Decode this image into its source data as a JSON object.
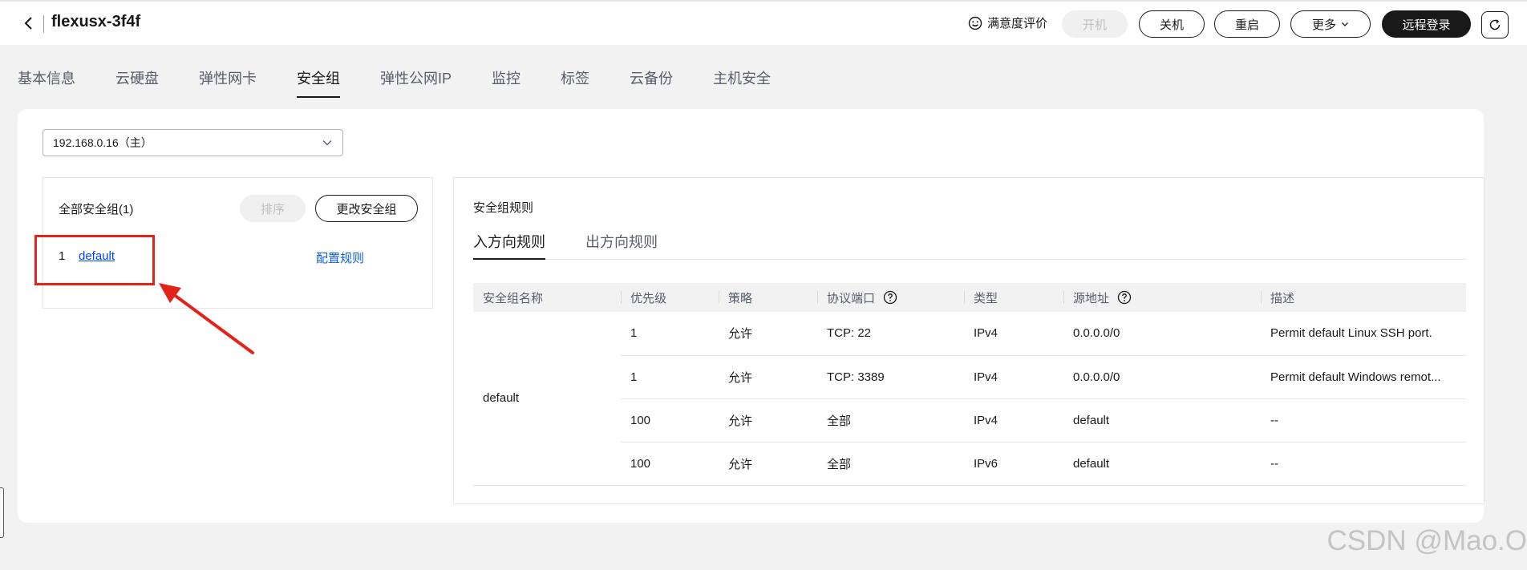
{
  "header": {
    "title": "flexusx-3f4f",
    "satisfaction": "满意度评价",
    "buttons": {
      "power_on": "开机",
      "shutdown": "关机",
      "restart": "重启",
      "more": "更多",
      "remote_login": "远程登录"
    }
  },
  "tabs": [
    "基本信息",
    "云硬盘",
    "弹性网卡",
    "安全组",
    "弹性公网IP",
    "监控",
    "标签",
    "云备份",
    "主机安全"
  ],
  "active_tab": "安全组",
  "ip_select": {
    "value": "192.168.0.16（主）"
  },
  "left_panel": {
    "title": "全部安全组(1)",
    "sort_label": "排序",
    "change_label": "更改安全组",
    "items": [
      {
        "index": "1",
        "name": "default",
        "action": "配置规则"
      }
    ]
  },
  "right_panel": {
    "title": "安全组规则",
    "tabs": [
      "入方向规则",
      "出方向规则"
    ],
    "columns": [
      "安全组名称",
      "优先级",
      "策略",
      "协议端口",
      "类型",
      "源地址",
      "描述"
    ],
    "group_name": "default",
    "rows": [
      {
        "priority": "1",
        "policy": "允许",
        "port": "TCP: 22",
        "type": "IPv4",
        "source": "0.0.0.0/0",
        "desc": "Permit default Linux SSH port."
      },
      {
        "priority": "1",
        "policy": "允许",
        "port": "TCP: 3389",
        "type": "IPv4",
        "source": "0.0.0.0/0",
        "desc": "Permit default Windows remot..."
      },
      {
        "priority": "100",
        "policy": "允许",
        "port": "全部",
        "type": "IPv4",
        "source": "default",
        "desc": "--"
      },
      {
        "priority": "100",
        "policy": "允许",
        "port": "全部",
        "type": "IPv6",
        "source": "default",
        "desc": "--"
      }
    ]
  },
  "watermark": "CSDN @Mao.O",
  "colors": {
    "link": "#0d5fe0",
    "annotation": "#e2231a",
    "primary_button": "#191919"
  }
}
